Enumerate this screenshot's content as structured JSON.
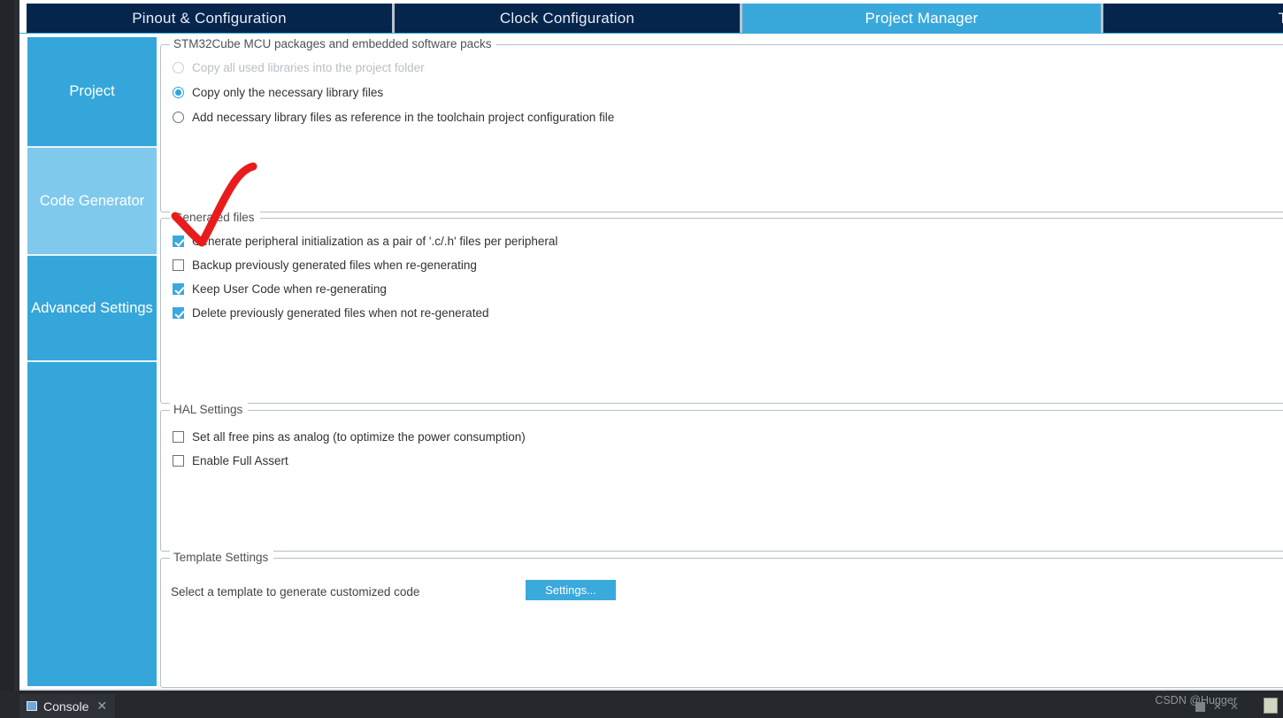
{
  "window": {
    "tabs": [
      {
        "label": "Pinout & Configuration",
        "active": false
      },
      {
        "label": "Clock Configuration",
        "active": false
      },
      {
        "label": "Project Manager",
        "active": true
      },
      {
        "label": "To",
        "active": false
      }
    ]
  },
  "sidebar": {
    "items": [
      {
        "label": "Project",
        "selected": false
      },
      {
        "label": "Code Generator",
        "selected": true
      },
      {
        "label": "Advanced Settings",
        "selected": false
      },
      {
        "label": "",
        "selected": false
      }
    ]
  },
  "groups": {
    "packages": {
      "title": "STM32Cube MCU packages and embedded software packs",
      "options": [
        {
          "label": "Copy all used libraries into the project folder",
          "checked": false,
          "disabled": true
        },
        {
          "label": "Copy only the necessary library files",
          "checked": true,
          "disabled": false
        },
        {
          "label": "Add necessary library files as reference in the toolchain project configuration file",
          "checked": false,
          "disabled": false
        }
      ]
    },
    "generated_files": {
      "title": "Generated files",
      "options": [
        {
          "label": "Generate peripheral initialization as a pair of '.c/.h' files per peripheral",
          "checked": true
        },
        {
          "label": "Backup previously generated files when re-generating",
          "checked": false
        },
        {
          "label": "Keep User Code when re-generating",
          "checked": true
        },
        {
          "label": "Delete previously generated files when not re-generated",
          "checked": true
        }
      ]
    },
    "hal_settings": {
      "title": "HAL Settings",
      "options": [
        {
          "label": "Set all free pins as analog (to optimize the power consumption)",
          "checked": false
        },
        {
          "label": "Enable Full Assert",
          "checked": false
        }
      ]
    },
    "template_settings": {
      "title": "Template Settings",
      "description": "Select a template to generate customized code",
      "button_label": "Settings..."
    }
  },
  "bottom": {
    "console_label": "Console",
    "close_glyph": "✕",
    "watermark": "CSDN @Hugger"
  },
  "colors": {
    "accent": "#39a9dc",
    "tab_inactive": "#05254d",
    "sidebar_selected": "#7fc9ec",
    "annotation_red": "#e81c1c"
  }
}
